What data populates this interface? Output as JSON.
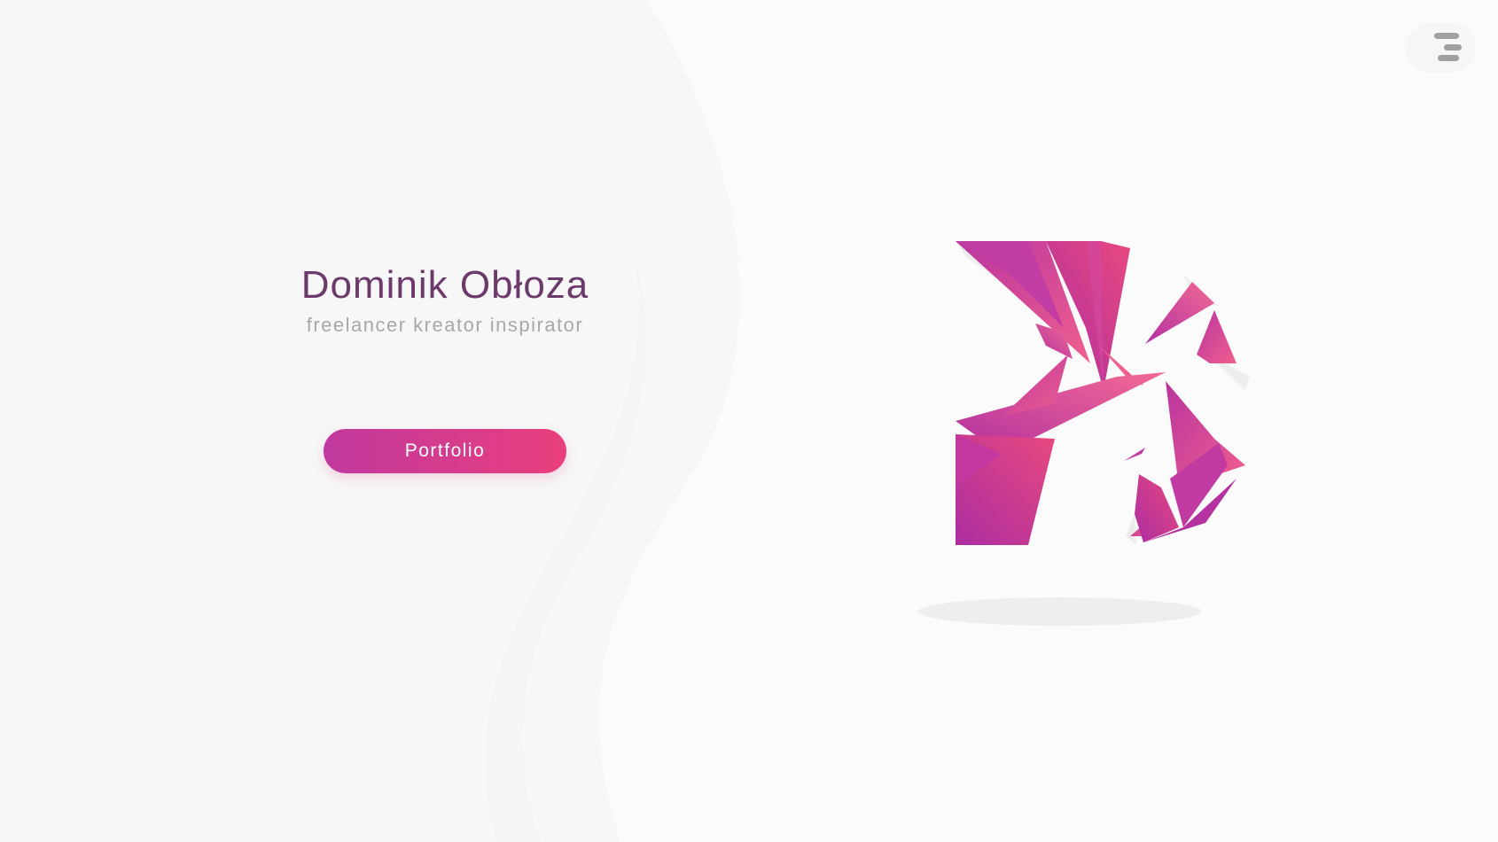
{
  "hero": {
    "name": "Dominik Obłoza",
    "tagline": "freelancer kreator inspirator"
  },
  "cta": {
    "portfolio_label": "Portfolio"
  },
  "header": {
    "menu_icon": "hamburger-menu-icon"
  },
  "logo": {
    "icon": "shattered-d-logo-icon"
  },
  "colors": {
    "background": "#fbfbfb",
    "name_text": "#6b3a6a",
    "tagline_text": "#a8a8a8",
    "gradient_start": "#c0399e",
    "gradient_end": "#ea3f7d",
    "menu_bars": "#a0a0a0"
  }
}
